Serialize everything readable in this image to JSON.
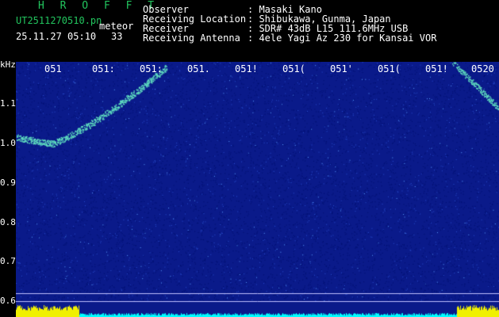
{
  "header": {
    "program": "H R O F F T",
    "file_name": "UT2511270510.pn",
    "mode": "meteor",
    "datetime": "25.11.27 05:10",
    "count": "33",
    "fields": [
      {
        "label": "Observer",
        "value": ": Masaki Kano"
      },
      {
        "label": "Receiving Location",
        "value": ": Shibukawa, Gunma, Japan"
      },
      {
        "label": "Receiver",
        "value": ": SDR# 43dB L15 111.6MHz USB"
      },
      {
        "label": "Receiving Antenna",
        "value": ": 4ele Yagi Az 230 for Kansai VOR"
      }
    ]
  },
  "axis": {
    "unit": "kHz",
    "y_ticks": [
      "1.1",
      "1.0",
      "0.9",
      "0.8",
      "0.7",
      "0.6"
    ],
    "x_ticks": [
      "051",
      "051:",
      "051:",
      "051.",
      "051!",
      "051(",
      "051'",
      "051(",
      "051!",
      "0520"
    ]
  },
  "colors": {
    "background": "#000000",
    "noise": "#0a1a8a",
    "echo": "#60e0c0",
    "signal_bar": "#f0f000",
    "baseline": "#00ffff"
  }
}
